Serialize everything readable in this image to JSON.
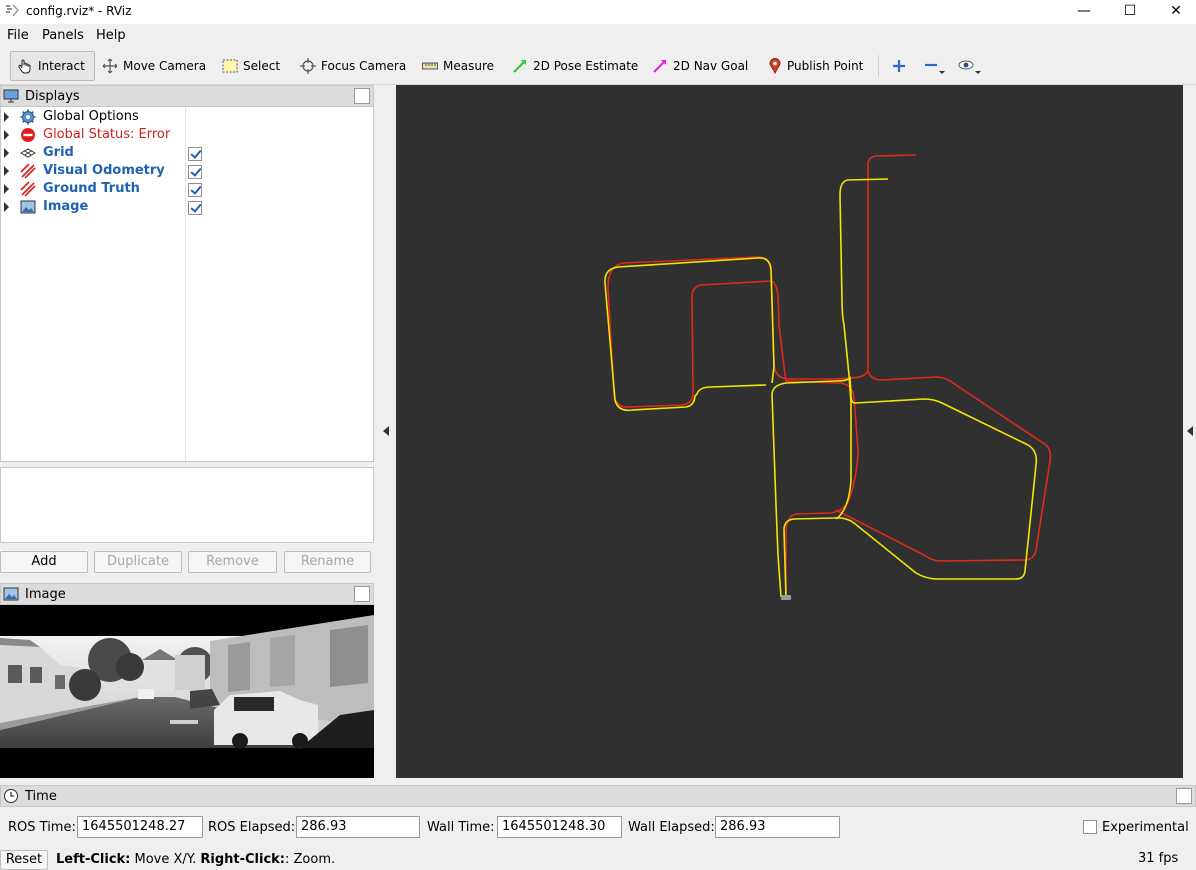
{
  "window": {
    "title": "config.rviz* - RViz",
    "minimize": "—",
    "maximize": "☐",
    "close": "✕"
  },
  "menu": {
    "file": "File",
    "panels": "Panels",
    "help": "Help"
  },
  "toolbar": {
    "interact": "Interact",
    "move_camera": "Move Camera",
    "select": "Select",
    "focus_camera": "Focus Camera",
    "measure": "Measure",
    "pose_estimate": "2D Pose Estimate",
    "nav_goal": "2D Nav Goal",
    "publish_point": "Publish Point"
  },
  "displays": {
    "title": "Displays",
    "items": [
      {
        "label": "Global Options",
        "style": "normal",
        "checked": null
      },
      {
        "label": "Global Status: Error",
        "style": "error",
        "checked": null
      },
      {
        "label": "Grid",
        "style": "bold",
        "checked": true
      },
      {
        "label": "Visual Odometry",
        "style": "bold",
        "checked": true
      },
      {
        "label": "Ground Truth",
        "style": "bold",
        "checked": true
      },
      {
        "label": "Image",
        "style": "bold",
        "checked": true
      }
    ],
    "buttons": {
      "add": "Add",
      "duplicate": "Duplicate",
      "remove": "Remove",
      "rename": "Rename"
    }
  },
  "image_panel": {
    "title": "Image"
  },
  "time_panel": {
    "title": "Time",
    "ros_time_label": "ROS Time:",
    "ros_time": "1645501248.27",
    "ros_elapsed_label": "ROS Elapsed:",
    "ros_elapsed": "286.93",
    "wall_time_label": "Wall Time:",
    "wall_time": "1645501248.30",
    "wall_elapsed_label": "Wall Elapsed:",
    "wall_elapsed": "286.93",
    "experimental": "Experimental"
  },
  "status": {
    "reset": "Reset",
    "left_click": "Left-Click:",
    "left_click_action": " Move X/Y. ",
    "right_click": "Right-Click:",
    "right_click_action": ": Zoom.",
    "fps": "31 fps"
  },
  "colors": {
    "background_3d": "#303030",
    "ground_truth": "#e02a1a",
    "visual_odometry": "#f2e600",
    "link_blue": "#1f62b5",
    "error_red": "#cc2222"
  }
}
